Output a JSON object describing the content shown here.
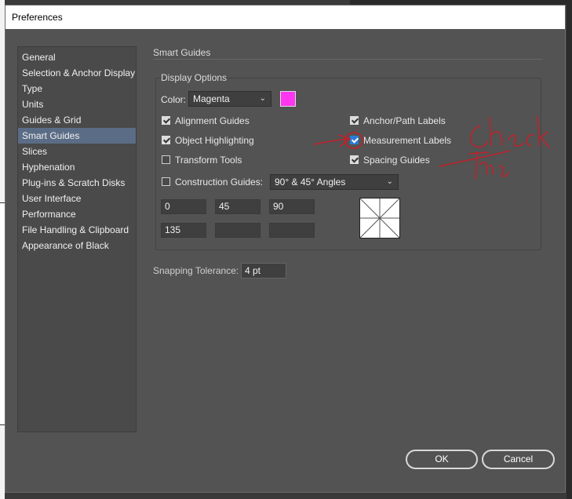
{
  "window": {
    "title": "Preferences"
  },
  "sidebar": {
    "items": [
      {
        "label": "General"
      },
      {
        "label": "Selection & Anchor Display"
      },
      {
        "label": "Type"
      },
      {
        "label": "Units"
      },
      {
        "label": "Guides & Grid"
      },
      {
        "label": "Smart Guides",
        "selected": true
      },
      {
        "label": "Slices"
      },
      {
        "label": "Hyphenation"
      },
      {
        "label": "Plug-ins & Scratch Disks"
      },
      {
        "label": "User Interface"
      },
      {
        "label": "Performance"
      },
      {
        "label": "File Handling & Clipboard"
      },
      {
        "label": "Appearance of Black"
      }
    ]
  },
  "main": {
    "section_title": "Smart Guides",
    "display_options": {
      "title": "Display Options",
      "color_label": "Color:",
      "color_value": "Magenta",
      "swatch_color": "#ff35f0",
      "checkboxes": {
        "alignment_guides": {
          "label": "Alignment Guides",
          "checked": true
        },
        "object_highlighting": {
          "label": "Object Highlighting",
          "checked": true
        },
        "transform_tools": {
          "label": "Transform Tools",
          "checked": false
        },
        "anchor_path_labels": {
          "label": "Anchor/Path Labels",
          "checked": true
        },
        "measurement_labels": {
          "label": "Measurement Labels",
          "checked": true
        },
        "spacing_guides": {
          "label": "Spacing Guides",
          "checked": true
        },
        "construction_guides": {
          "label": "Construction Guides:",
          "checked": false
        }
      },
      "construction_angles": "90° & 45° Angles",
      "angle_fields": [
        "0",
        "45",
        "90",
        "135",
        "",
        ""
      ]
    },
    "snapping_label": "Snapping Tolerance:",
    "snapping_value": "4 pt"
  },
  "footer": {
    "ok_label": "OK",
    "cancel_label": "Cancel"
  },
  "annotation": {
    "text": "Check This"
  },
  "colors": {
    "accent": "#5b6d86",
    "checkbox_focus": "#2d7bd6",
    "annotation": "#c0202a"
  }
}
